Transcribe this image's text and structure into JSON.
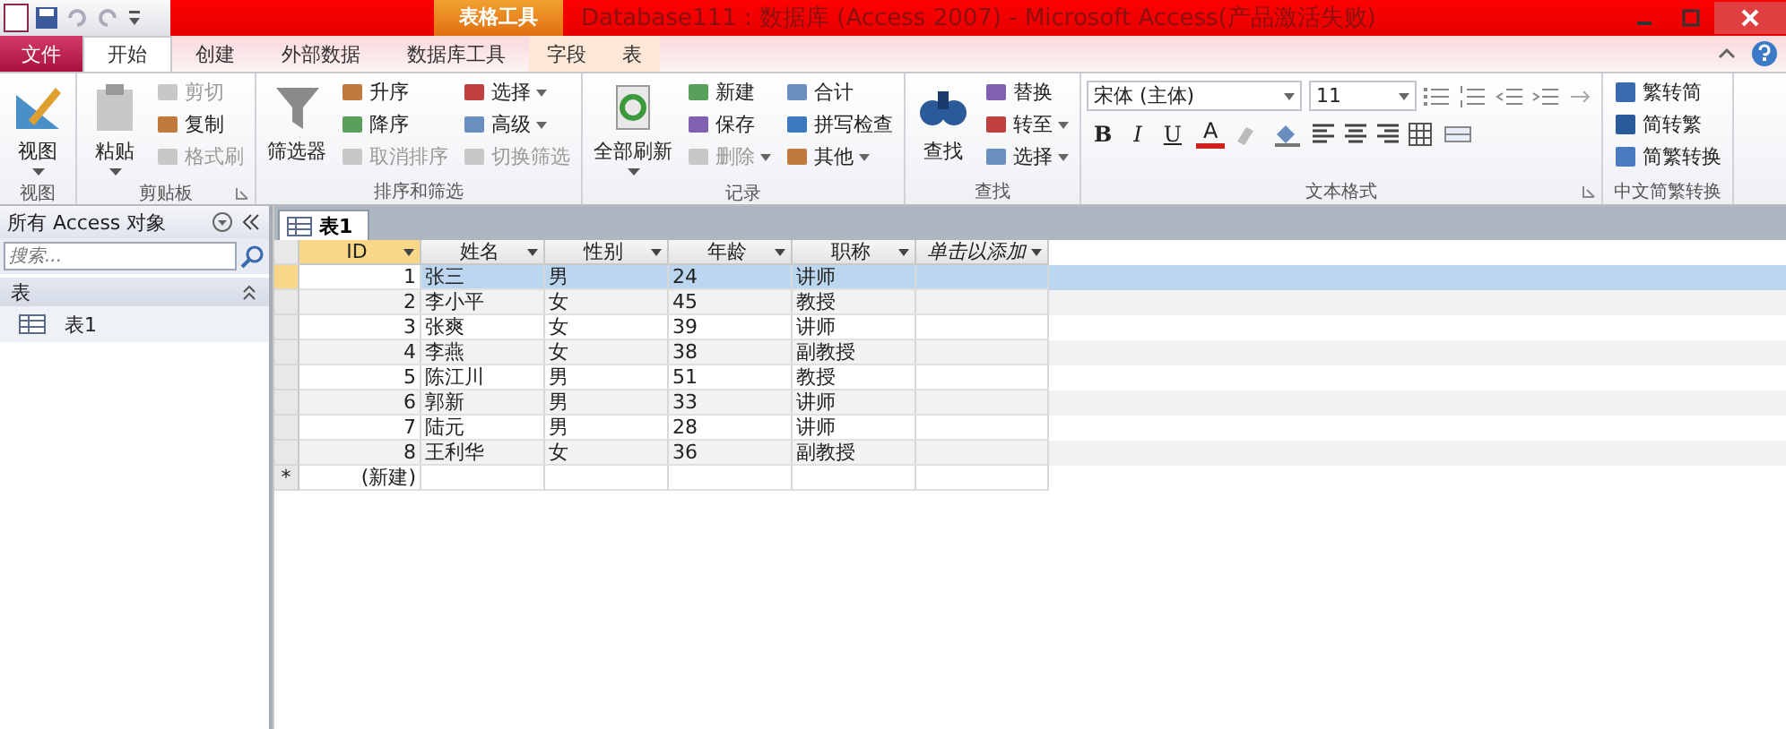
{
  "title_bar": {
    "context_tab": "表格工具",
    "title": "Database111 : 数据库 (Access 2007) - Microsoft Access(产品激活失败)"
  },
  "tabs": [
    {
      "label": "文件",
      "kind": "file",
      "selected": false
    },
    {
      "label": "开始",
      "kind": "normal",
      "selected": true
    },
    {
      "label": "创建",
      "kind": "normal",
      "selected": false
    },
    {
      "label": "外部数据",
      "kind": "normal",
      "selected": false
    },
    {
      "label": "数据库工具",
      "kind": "normal",
      "selected": false
    },
    {
      "label": "字段",
      "kind": "context",
      "selected": false
    },
    {
      "label": "表",
      "kind": "context",
      "selected": false
    }
  ],
  "ribbon": [
    {
      "name": "视图",
      "launcher": false,
      "large": [
        {
          "label": "视图",
          "dropdown": true
        }
      ]
    },
    {
      "name": "剪贴板",
      "launcher": true,
      "large": [
        {
          "label": "粘贴",
          "dropdown": true
        }
      ],
      "columns": [
        [
          {
            "label": "剪切",
            "disabled": true,
            "dropdown": false
          },
          {
            "label": "复制",
            "disabled": false,
            "dropdown": false
          },
          {
            "label": "格式刷",
            "disabled": true,
            "dropdown": false
          }
        ]
      ]
    },
    {
      "name": "排序和筛选",
      "launcher": false,
      "large": [
        {
          "label": "筛选器",
          "dropdown": false
        }
      ],
      "columns": [
        [
          {
            "label": "升序",
            "disabled": false,
            "dropdown": false
          },
          {
            "label": "降序",
            "disabled": false,
            "dropdown": false
          },
          {
            "label": "取消排序",
            "disabled": true,
            "dropdown": false
          }
        ],
        [
          {
            "label": "选择",
            "disabled": false,
            "dropdown": true
          },
          {
            "label": "高级",
            "disabled": false,
            "dropdown": true
          },
          {
            "label": "切换筛选",
            "disabled": true,
            "dropdown": false
          }
        ]
      ]
    },
    {
      "name": "记录",
      "launcher": false,
      "large": [
        {
          "label": "全部刷新",
          "dropdown": true
        }
      ],
      "columns": [
        [
          {
            "label": "新建",
            "disabled": false,
            "dropdown": false
          },
          {
            "label": "保存",
            "disabled": false,
            "dropdown": false
          },
          {
            "label": "删除",
            "disabled": true,
            "dropdown": true
          }
        ],
        [
          {
            "label": "合计",
            "disabled": false,
            "dropdown": false
          },
          {
            "label": "拼写检查",
            "disabled": false,
            "dropdown": false
          },
          {
            "label": "其他",
            "disabled": false,
            "dropdown": true
          }
        ]
      ]
    },
    {
      "name": "查找",
      "launcher": false,
      "large": [
        {
          "label": "查找",
          "dropdown": false
        }
      ],
      "columns": [
        [
          {
            "label": "替换",
            "disabled": false,
            "dropdown": false
          },
          {
            "label": "转至",
            "disabled": false,
            "dropdown": true
          },
          {
            "label": "选择",
            "disabled": false,
            "dropdown": true
          }
        ]
      ]
    }
  ],
  "text_format": {
    "name": "文本格式",
    "font": "宋体 (主体)",
    "size": "11",
    "bold": "B",
    "italic": "I",
    "underline": "U",
    "font_color": "A"
  },
  "chinese_conversion": {
    "name": "中文简繁转换",
    "items": [
      "繁转简",
      "简转繁",
      "简繁转换"
    ]
  },
  "nav_pane": {
    "title": "所有 Access 对象",
    "search_placeholder": "搜索...",
    "groups": [
      {
        "label": "表",
        "expanded": true,
        "items": [
          "表1"
        ]
      }
    ]
  },
  "document_tabs": [
    {
      "label": "表1",
      "selected": true
    }
  ],
  "table": {
    "columns": [
      {
        "label": "ID",
        "kind": "field"
      },
      {
        "label": "姓名",
        "kind": "field"
      },
      {
        "label": "性别",
        "kind": "field"
      },
      {
        "label": "年龄",
        "kind": "field"
      },
      {
        "label": "职称",
        "kind": "field"
      },
      {
        "label": "单击以添加",
        "kind": "add"
      }
    ],
    "rows": [
      {
        "cells": [
          "1",
          "张三",
          "男",
          "24",
          "讲师"
        ],
        "selected": true
      },
      {
        "cells": [
          "2",
          "李小平",
          "女",
          "45",
          "教授"
        ],
        "selected": false
      },
      {
        "cells": [
          "3",
          "张爽",
          "女",
          "39",
          "讲师"
        ],
        "selected": false
      },
      {
        "cells": [
          "4",
          "李燕",
          "女",
          "38",
          "副教授"
        ],
        "selected": false
      },
      {
        "cells": [
          "5",
          "陈江川",
          "男",
          "51",
          "教授"
        ],
        "selected": false
      },
      {
        "cells": [
          "6",
          "郭新",
          "男",
          "33",
          "讲师"
        ],
        "selected": false
      },
      {
        "cells": [
          "7",
          "陆元",
          "男",
          "28",
          "讲师"
        ],
        "selected": false
      },
      {
        "cells": [
          "8",
          "王利华",
          "女",
          "36",
          "副教授"
        ],
        "selected": false
      }
    ],
    "new_row": {
      "marker": "*",
      "label": "(新建)"
    }
  }
}
